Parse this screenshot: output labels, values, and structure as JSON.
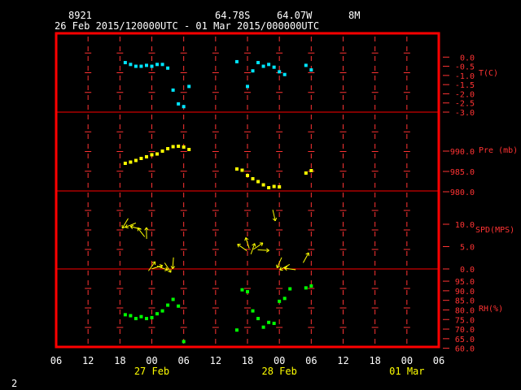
{
  "header": {
    "station_id": "8921",
    "lat": "64.78S",
    "lon": "64.07W",
    "elevation": "8M",
    "time_range": "26 Feb 2015/120000UTC - 01 Mar 2015/000000UTC"
  },
  "footer": {
    "page_number": "2"
  },
  "colors": {
    "frame": "#ff0000",
    "temperature": "#00e5ff",
    "pressure": "#ffff00",
    "wind": "#ffff00",
    "humidity": "#00ff00"
  },
  "chart_data": {
    "type": "scatter",
    "x_unit": "hours from 26 Feb 2015 06UTC",
    "x_range": [
      0,
      72
    ],
    "x_tick_labels": [
      "06",
      "12",
      "18",
      "00",
      "06",
      "12",
      "18",
      "00",
      "06",
      "12",
      "18",
      "00",
      "06"
    ],
    "date_labels": [
      "27 Feb",
      "28 Feb",
      "01 Mar"
    ],
    "panels": [
      {
        "name": "T(C)",
        "ylim": [
          -3.0,
          0.5
        ],
        "y_ticks": [
          "0.0",
          "-0.5",
          "-1.0",
          "-1.5",
          "-2.0",
          "-2.5",
          "-3.0"
        ],
        "points": [
          [
            13,
            -0.3
          ],
          [
            14,
            -0.4
          ],
          [
            15,
            -0.5
          ],
          [
            16,
            -0.5
          ],
          [
            17,
            -0.45
          ],
          [
            18,
            -0.5
          ],
          [
            19,
            -0.4
          ],
          [
            20,
            -0.4
          ],
          [
            21,
            -0.6
          ],
          [
            22,
            -1.8
          ],
          [
            23,
            -2.55
          ],
          [
            24,
            -2.7
          ],
          [
            25,
            -1.6
          ],
          [
            34,
            -0.25
          ],
          [
            36,
            -1.6
          ],
          [
            37,
            -0.75
          ],
          [
            38,
            -0.3
          ],
          [
            39,
            -0.5
          ],
          [
            40,
            -0.4
          ],
          [
            41,
            -0.55
          ],
          [
            42,
            -0.8
          ],
          [
            43,
            -0.95
          ],
          [
            47,
            -0.45
          ],
          [
            48,
            -0.7
          ]
        ]
      },
      {
        "name": "Pre (mb)",
        "ylim": [
          979.0,
          995.0
        ],
        "y_ticks": [
          "990.0",
          "985.0",
          "980.0"
        ],
        "points": [
          [
            13,
            987.0
          ],
          [
            14,
            987.3
          ],
          [
            15,
            987.7
          ],
          [
            16,
            988.2
          ],
          [
            17,
            988.6
          ],
          [
            18,
            989.1
          ],
          [
            19,
            989.3
          ],
          [
            20,
            990.0
          ],
          [
            21,
            990.6
          ],
          [
            22,
            991.1
          ],
          [
            23,
            991.2
          ],
          [
            24,
            991.0
          ],
          [
            25,
            990.4
          ],
          [
            34,
            985.6
          ],
          [
            35,
            985.3
          ],
          [
            36,
            984.0
          ],
          [
            37,
            983.2
          ],
          [
            38,
            982.5
          ],
          [
            39,
            981.7
          ],
          [
            40,
            981.0
          ],
          [
            41,
            981.3
          ],
          [
            42,
            981.2
          ],
          [
            47,
            984.6
          ],
          [
            48,
            985.2
          ]
        ]
      },
      {
        "name": "SPD(MPS)",
        "ylim": [
          0,
          14
        ],
        "y_ticks": [
          "10.0",
          "5.0",
          "0.0"
        ],
        "points": [
          [
            13,
            10.2
          ],
          [
            14,
            9.8
          ],
          [
            15,
            9.2
          ],
          [
            16,
            8.2
          ],
          [
            17,
            8.0
          ],
          [
            18,
            0.6
          ],
          [
            19,
            0.4
          ],
          [
            20,
            0.2
          ],
          [
            21,
            0.3
          ],
          [
            22,
            1.3
          ],
          [
            35,
            4.8
          ],
          [
            36,
            5.8
          ],
          [
            37,
            4.5
          ],
          [
            38,
            5.1
          ],
          [
            39,
            4.2
          ],
          [
            41,
            12.0
          ],
          [
            42,
            1.4
          ],
          [
            43,
            0.4
          ],
          [
            44,
            0.0
          ],
          [
            47,
            2.5
          ]
        ]
      },
      {
        "name": "RH(%)",
        "ylim": [
          59,
          98
        ],
        "y_ticks": [
          "95.0",
          "90.0",
          "85.0",
          "80.0",
          "75.0",
          "70.0",
          "65.0",
          "60.0"
        ],
        "points": [
          [
            13,
            77.5
          ],
          [
            14,
            77.0
          ],
          [
            15,
            75.5
          ],
          [
            16,
            76.5
          ],
          [
            17,
            75.5
          ],
          [
            18,
            76.0
          ],
          [
            19,
            78.0
          ],
          [
            20,
            79.5
          ],
          [
            21,
            82.5
          ],
          [
            22,
            85.5
          ],
          [
            23,
            82.0
          ],
          [
            24,
            63.5
          ],
          [
            34,
            69.5
          ],
          [
            35,
            90.5
          ],
          [
            36,
            89.5
          ],
          [
            37,
            79.5
          ],
          [
            38,
            75.5
          ],
          [
            39,
            71.0
          ],
          [
            40,
            73.5
          ],
          [
            41,
            73.0
          ],
          [
            42,
            84.5
          ],
          [
            43,
            86.0
          ],
          [
            44,
            91.0
          ],
          [
            47,
            91.5
          ],
          [
            48,
            92.5
          ]
        ]
      }
    ]
  }
}
